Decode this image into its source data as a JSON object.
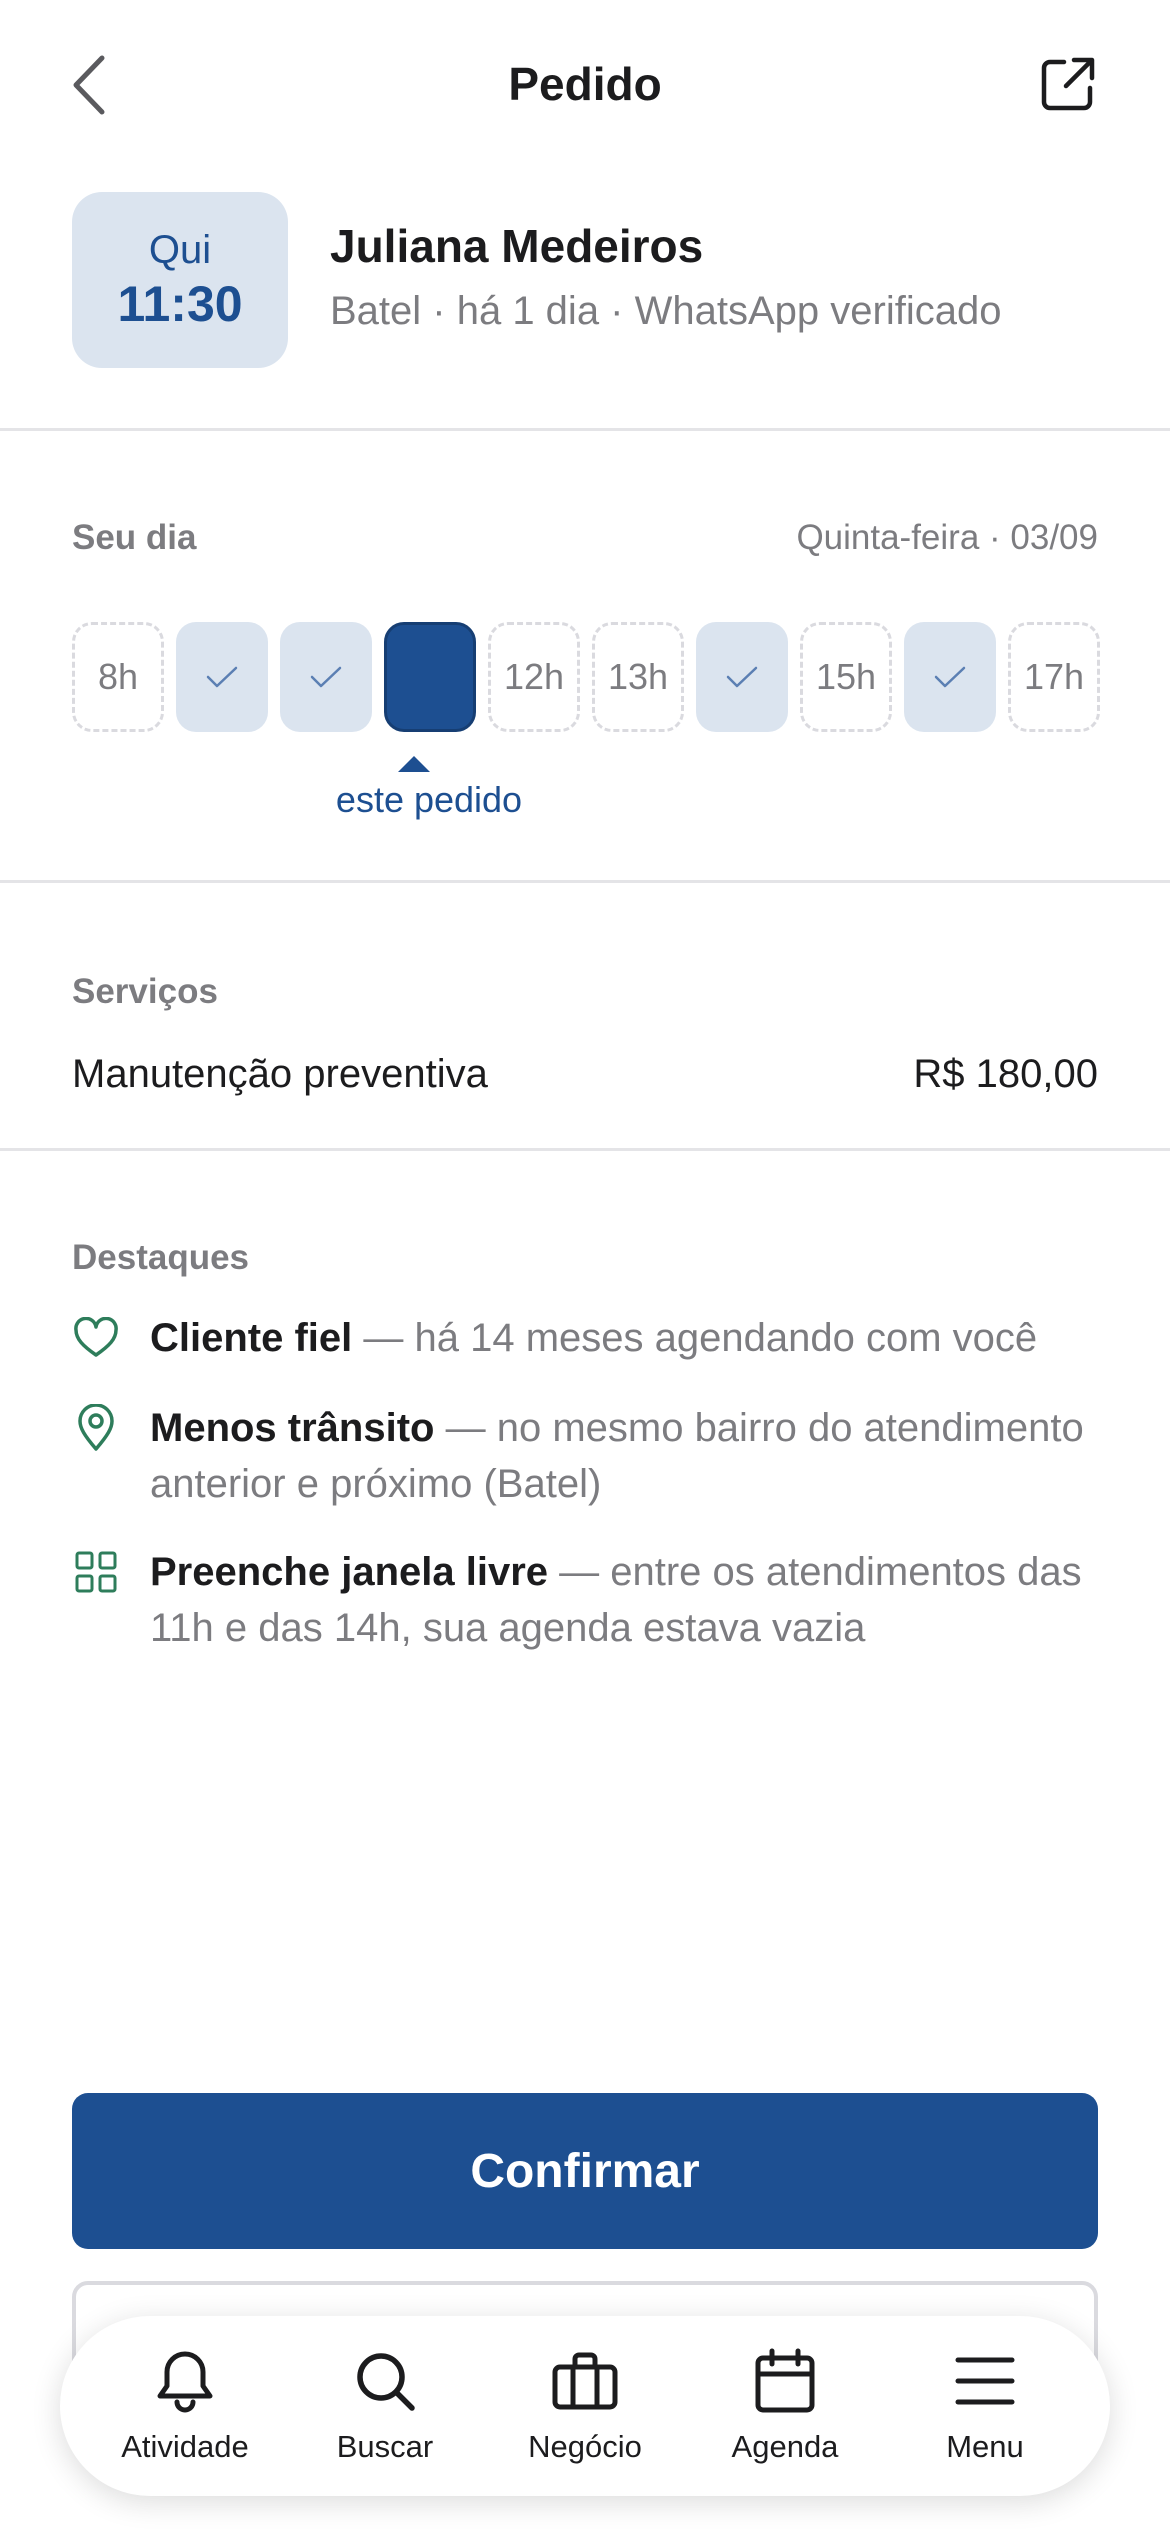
{
  "header": {
    "title": "Pedido"
  },
  "client": {
    "day": "Qui",
    "time": "11:30",
    "name": "Juliana Medeiros",
    "meta": "Batel · há 1 dia · WhatsApp verificado"
  },
  "day": {
    "label": "Seu dia",
    "date": "Quinta-feira · 03/09",
    "slots": [
      {
        "label": "8h",
        "state": "free"
      },
      {
        "label": "",
        "state": "booked"
      },
      {
        "label": "",
        "state": "booked"
      },
      {
        "label": "",
        "state": "current"
      },
      {
        "label": "12h",
        "state": "free"
      },
      {
        "label": "13h",
        "state": "free"
      },
      {
        "label": "",
        "state": "booked"
      },
      {
        "label": "15h",
        "state": "free"
      },
      {
        "label": "",
        "state": "booked"
      },
      {
        "label": "17h",
        "state": "free"
      }
    ],
    "current_label": "este pedido"
  },
  "services": {
    "label": "Serviços",
    "items": [
      {
        "name": "Manutenção preventiva",
        "price": "R$ 180,00"
      }
    ]
  },
  "highlights": {
    "label": "Destaques",
    "items": [
      {
        "icon": "heart-icon",
        "title": "Cliente fiel",
        "text": " — há 14 meses agendando com você"
      },
      {
        "icon": "map-pin-icon",
        "title": "Menos trânsito",
        "text": " — no mesmo bairro do atendimento anterior e próximo (Batel)"
      },
      {
        "icon": "grid-icon",
        "title": "Preenche janela livre",
        "text": " — entre os atendimentos das 11h e das 14h, sua agenda estava vazia"
      }
    ]
  },
  "actions": {
    "confirm": "Confirmar"
  },
  "tabbar": {
    "items": [
      {
        "label": "Atividade",
        "icon": "bell-icon"
      },
      {
        "label": "Buscar",
        "icon": "search-icon"
      },
      {
        "label": "Negócio",
        "icon": "briefcase-icon"
      },
      {
        "label": "Agenda",
        "icon": "calendar-icon"
      },
      {
        "label": "Menu",
        "icon": "menu-icon"
      }
    ]
  },
  "colors": {
    "accent": "#1d4f91",
    "accent_light": "#dbe4ef",
    "highlight_icon": "#2e7d5b",
    "muted_text": "#7c7c80"
  }
}
